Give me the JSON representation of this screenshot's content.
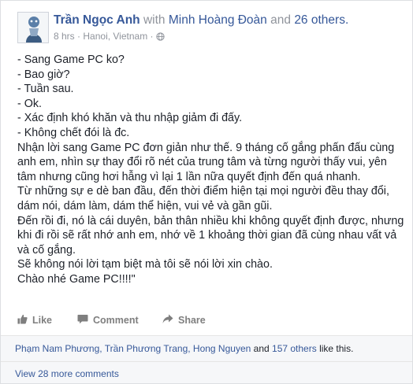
{
  "post": {
    "author": "Trần Ngọc Anh",
    "with_word": "with",
    "tagged_friend": "Minh Hoàng Đoàn",
    "and_word": "and",
    "others_link": "26 others.",
    "time": "8 hrs",
    "separator": "·",
    "location": "Hanoi, Vietnam",
    "privacy_separator": "·",
    "privacy_icon": "globe-icon",
    "lines": [
      "- Sang Game PC ko?",
      "- Bao giờ?",
      "- Tuần sau.",
      "- Ok.",
      "- Xác định khó khăn và thu nhập giảm đi đấy.",
      "- Không chết đói là đc.",
      "Nhận lời sang Game PC đơn giản như thế. 9 tháng cố gắng phấn đấu cùng anh em, nhìn sự thay đổi rõ nét của trung tâm và từng người thấy vui, yên tâm nhưng cũng hơi hẫng vì lại 1 lần nữa quyết định đến quá nhanh.",
      "Từ những sự e dè ban đầu, đến thời điểm hiện tại mọi người đều thay đổi, dám nói, dám làm, dám thể hiện, vui vẻ và gần gũi.",
      "Đến rồi đi, nó là cái duyên, bản thân nhiều khi không quyết định được, nhưng khi đi rồi sẽ rất nhớ anh em, nhớ về 1 khoảng thời gian đã cùng nhau vất vả và cố gắng.",
      "Sẽ không nói lời tạm biệt mà tôi sẽ nói lời xin chào.",
      "Chào nhé Game PC!!!!\""
    ]
  },
  "actions": {
    "like": "Like",
    "comment": "Comment",
    "share": "Share"
  },
  "likes": {
    "names": "Phạm Nam Phương, Trần Phương Trang, Hong Nguyen",
    "and_word": "and",
    "others_link": "157 others",
    "suffix": "like this."
  },
  "comments": {
    "view_more": "View 28 more comments"
  },
  "colors": {
    "link": "#365899",
    "muted": "#90949c",
    "text": "#1d2129"
  }
}
